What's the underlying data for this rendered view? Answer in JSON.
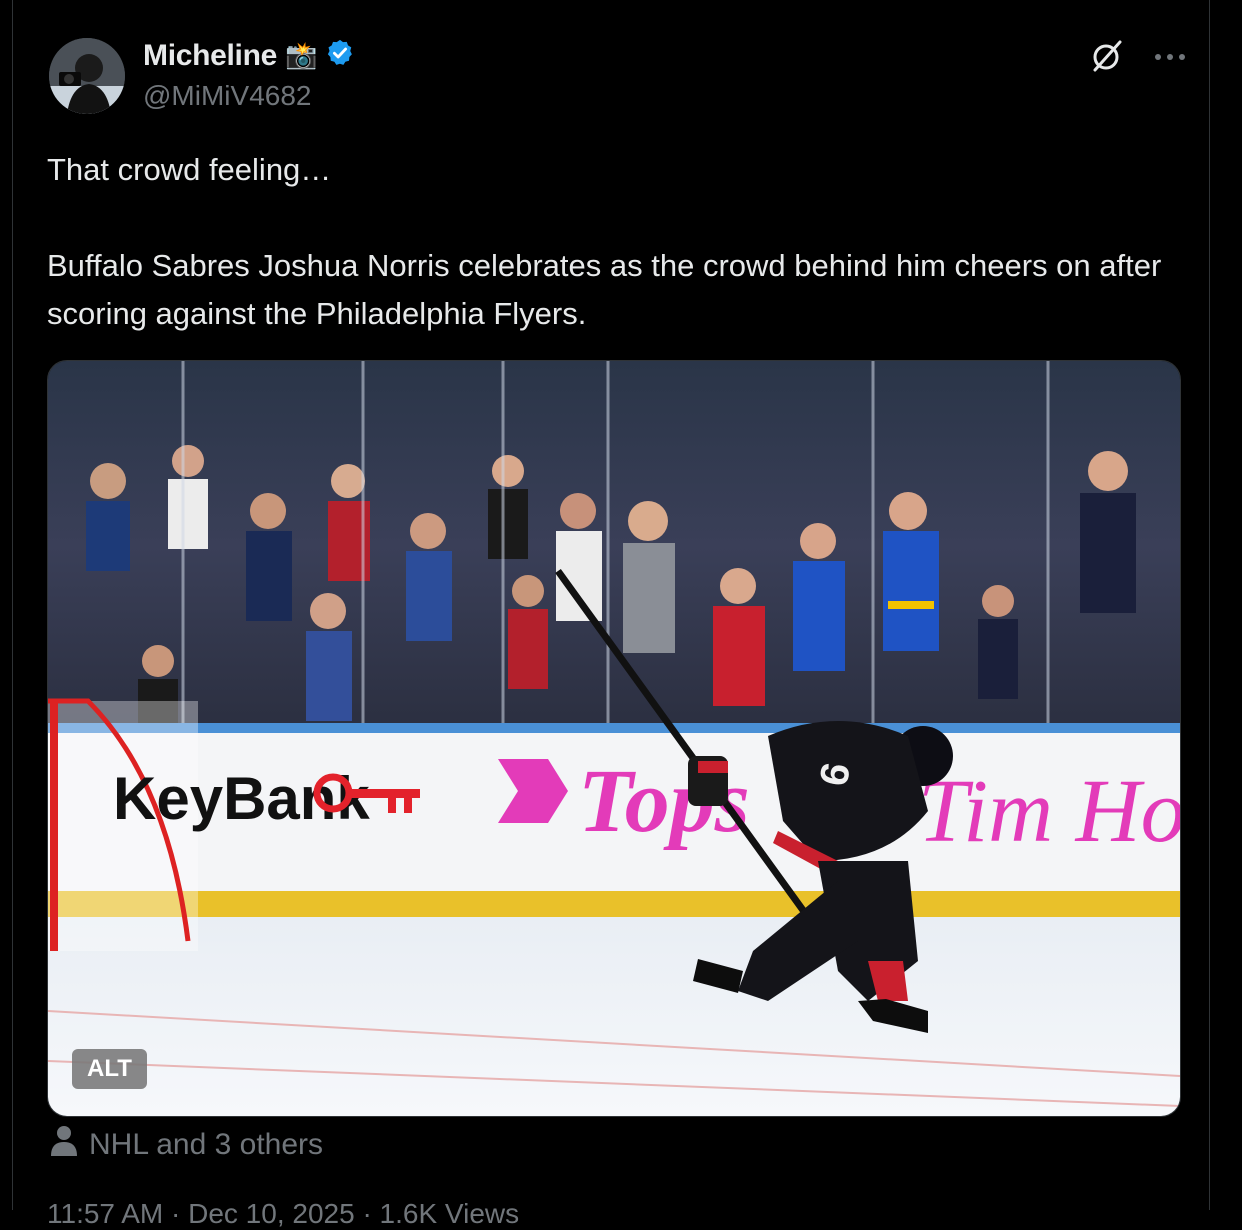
{
  "author": {
    "name": "Micheline",
    "name_emoji": "📸",
    "handle": "@MiMiV4682",
    "verified": true,
    "verified_color": "#1d9bf0"
  },
  "header_icons": [
    "grok-icon",
    "more-icon"
  ],
  "tweet": {
    "line1": "That crowd feeling…",
    "line2": "Buffalo Sabres Joshua Norris celebrates as the crowd behind him cheers on after scoring against the Philadelphia Flyers."
  },
  "media": {
    "alt_label": "ALT",
    "boards": {
      "keybank": "KeyBank",
      "tops": "Tops",
      "timhortons": "Tim Hortons"
    },
    "jersey_number": "9"
  },
  "tagged": {
    "icon": "person-icon",
    "text": "NHL and 3 others"
  },
  "meta_partial": "11:57 AM · Dec 10, 2025 · 1.6K Views"
}
